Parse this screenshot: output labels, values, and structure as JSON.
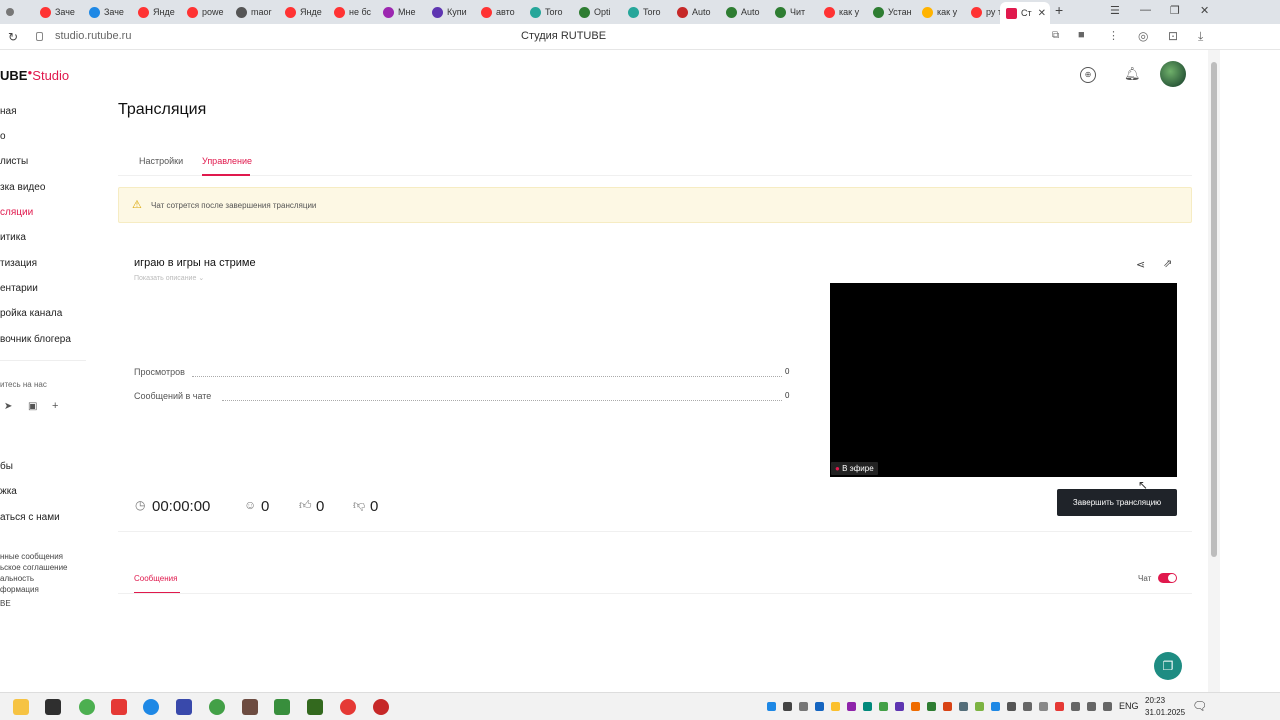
{
  "browser": {
    "tabs": [
      {
        "label": "Заче",
        "color": "#ff3333"
      },
      {
        "label": "Заче",
        "color": "#1e88e5"
      },
      {
        "label": "Янде",
        "color": "#ff3333"
      },
      {
        "label": "powe",
        "color": "#ff3333"
      },
      {
        "label": "maor",
        "color": "#555555"
      },
      {
        "label": "Янде",
        "color": "#ff3333"
      },
      {
        "label": "не бс",
        "color": "#ff3333"
      },
      {
        "label": "Мне",
        "color": "#9c27b0"
      },
      {
        "label": "Купи",
        "color": "#5e35b1"
      },
      {
        "label": "авто",
        "color": "#ff3333"
      },
      {
        "label": "Toro",
        "color": "#26a69a"
      },
      {
        "label": "Opti",
        "color": "#2e7d32"
      },
      {
        "label": "Toro",
        "color": "#26a69a"
      },
      {
        "label": "Auto",
        "color": "#c62828"
      },
      {
        "label": "Auto",
        "color": "#2e7d32"
      },
      {
        "label": "Чит",
        "color": "#2e7d32"
      },
      {
        "label": "как у",
        "color": "#ff3333"
      },
      {
        "label": "Устан",
        "color": "#2e7d32"
      },
      {
        "label": "как у",
        "color": "#ffb300"
      },
      {
        "label": "ру ту",
        "color": "#ff3333"
      }
    ],
    "active_tab": {
      "label": "Ст",
      "color": "#e0194d"
    },
    "new_tab": "+",
    "url": "studio.rutube.ru",
    "page_title": "Студия RUTUBE"
  },
  "sidebar": {
    "logo_left": "UBE",
    "logo_right": "Studio",
    "items": [
      {
        "label": "ная"
      },
      {
        "label": "о"
      },
      {
        "label": "листы"
      },
      {
        "label": "зка видео"
      },
      {
        "label": "сляции"
      },
      {
        "label": "итика"
      },
      {
        "label": "тизация"
      },
      {
        "label": "ентарии"
      },
      {
        "label": "ройка канала"
      },
      {
        "label": "вочник блогера"
      }
    ],
    "subscribe_label": "итесь на нас",
    "bottom_items": [
      {
        "label": "бы"
      },
      {
        "label": "жка"
      },
      {
        "label": "аться с нами"
      }
    ],
    "footer_links": [
      {
        "label": "нные сообщения"
      },
      {
        "label": "ьское соглашение"
      },
      {
        "label": "альность"
      },
      {
        "label": "формация"
      },
      {
        "label": "BE"
      }
    ]
  },
  "page": {
    "title": "Трансляция",
    "tabs": [
      {
        "label": "Настройки"
      },
      {
        "label": "Управление"
      }
    ],
    "alert_text": "Чат сотрется после завершения трансляции",
    "stream": {
      "title": "играю в игры на стриме",
      "show_description": "Показать описание",
      "stats": [
        {
          "label": "Просмотров",
          "value": "0"
        },
        {
          "label": "Сообщений в чате",
          "value": "0"
        }
      ],
      "live_badge": "В эфире",
      "duration": "00:00:00",
      "viewers": "0",
      "likes": "0",
      "dislikes": "0",
      "end_button": "Завершить трансляцию"
    },
    "chat": {
      "tab_label": "Сообщения",
      "toggle_label": "Чат",
      "toggle_on": true
    }
  },
  "taskbar": {
    "language": "ENG",
    "time": "20:23",
    "date": "31.01.2025"
  },
  "colors": {
    "accent": "#e0194d",
    "alert_bg": "#fdf8e4",
    "video_bg": "#000000",
    "button_bg": "#1f2329"
  }
}
